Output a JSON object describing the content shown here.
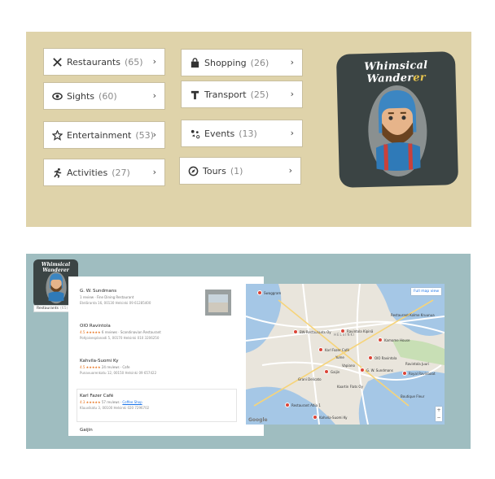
{
  "categories_left": [
    {
      "label": "Restaurants",
      "count": "(65)",
      "icon": "cutlery-icon"
    },
    {
      "label": "Sights",
      "count": "(60)",
      "icon": "eye-icon"
    },
    {
      "label": "Entertainment",
      "count": "(53)",
      "icon": "star-icon"
    },
    {
      "label": "Activities",
      "count": "(27)",
      "icon": "runner-icon"
    }
  ],
  "categories_right": [
    {
      "label": "Shopping",
      "count": "(26)",
      "icon": "shopping-bag-icon"
    },
    {
      "label": "Transport",
      "count": "(25)",
      "icon": "transport-t-icon"
    },
    {
      "label": "Events",
      "count": "(13)",
      "icon": "confetti-icon"
    },
    {
      "label": "Tours",
      "count": "(1)",
      "icon": "compass-icon"
    }
  ],
  "chevron": "›",
  "logo": {
    "title_main": "Whimsical Wander",
    "title_accent": "er"
  },
  "mini": {
    "title": "Whimsical Wanderer",
    "dropdown_label": "Restaurants",
    "dropdown_count": "(65)",
    "chevron": "⌄"
  },
  "results": [
    {
      "name": "G. W. Sundmans",
      "meta": "1 review · Fine Dining Restaurant",
      "addr": "Eteläranta 16, 00130 Helsinki  09 61285400"
    },
    {
      "name": "OlO Ravintola",
      "rating": "4.5",
      "stars": "★★★★★",
      "meta": "6 reviews · Scandinavian Restaurant",
      "addr": "Pohjoisesplanadi 5, 00170 Helsinki  010 3206250"
    },
    {
      "name": "Kahvila-Suomi Ky",
      "rating": "4.5",
      "stars": "★★★★★",
      "meta": "24 reviews · Cafe",
      "addr": "Punavuorenkatu 12, 00150 Helsinki  09 657422"
    },
    {
      "name": "Karl Fazer Café",
      "rating": "4.3",
      "stars": "★★★★★",
      "meta": "57 reviews ·",
      "link": "Coffee Shop",
      "addr": "Kluuvikatu 3, 00100 Helsinki  020 7296702"
    },
    {
      "name": "Gaijin",
      "meta": "",
      "addr": ""
    }
  ],
  "map": {
    "button": "Full map view",
    "google": "Google",
    "zoom_in": "+",
    "zoom_out": "−",
    "city_label": "HELSINKI",
    "places": [
      "Swaggram",
      "Restaurant Kolme Kruunua",
      "BW-Restaurants Oy",
      "Ravintola Kipinä",
      "Kamome House",
      "Karl Fazer Café",
      "Yume",
      "Vapiano",
      "OlO Ravintola",
      "Gaijin",
      "G. W. Sundmans",
      "Grani Delicato",
      "Ravintola Juuri",
      "Royal Ravintolat",
      "Kahvila-Suomi Ky",
      "Restaurant Atlia 1",
      "Kaartin Flats Oy",
      "Boutique Fleur"
    ]
  },
  "colors": {
    "top_bg": "#dfd3aa",
    "bottom_bg": "#9fbdc0",
    "logo_bg": "#3b4444",
    "accent": "#e7c44e",
    "pin": "#db4437"
  }
}
